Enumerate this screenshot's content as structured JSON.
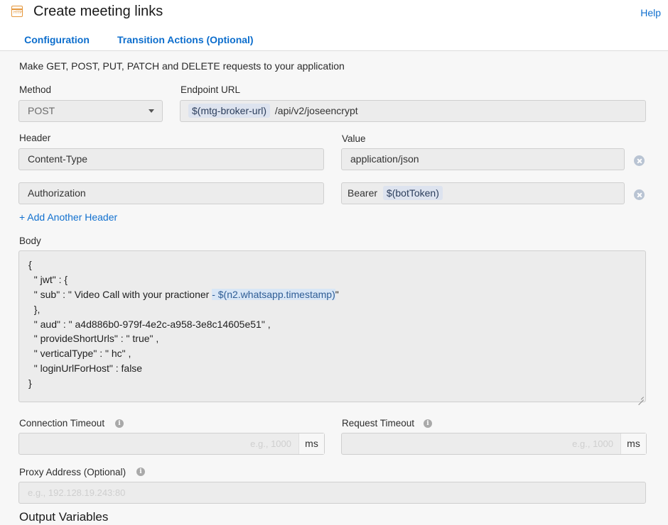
{
  "header": {
    "app_icon": "http-request-icon",
    "app_icon_text": "HTTP",
    "title": "Create meeting links",
    "help_label": "Help",
    "tabs": [
      {
        "label": "Configuration",
        "active": true
      },
      {
        "label": "Transition Actions (Optional)",
        "active": false
      }
    ]
  },
  "main": {
    "description": "Make GET, POST, PUT, PATCH and DELETE requests to your application",
    "method": {
      "label": "Method",
      "value": "POST"
    },
    "endpoint": {
      "label": "Endpoint URL",
      "variable": "$(mtg-broker-url)",
      "path": "/api/v2/joseencrypt"
    },
    "headers": {
      "header_label": "Header",
      "value_label": "Value",
      "rows": [
        {
          "header": "Content-Type",
          "value_text": "application/json",
          "value_var": ""
        },
        {
          "header": "Authorization",
          "value_text": "Bearer",
          "value_var": "$(botToken)"
        }
      ],
      "add_label": "+ Add Another Header"
    },
    "body": {
      "label": "Body",
      "lines": [
        "{",
        "  \" jwt\" : {",
        "  \" sub\" : \" Video Call with your practioner ",
        "  },",
        "  \" aud\" : \" a4d886b0-979f-4e2c-a958-3e8c14605e51\" ,",
        "  \" provideShortUrls\" : \" true\" ,",
        "  \" verticalType\" : \" hc\" ,",
        "  \" loginUrlForHost\" : false",
        "}"
      ],
      "sub_variable": "- $(n2.whatsapp.timestamp)",
      "sub_suffix": "\""
    },
    "connection_timeout": {
      "label": "Connection Timeout",
      "placeholder": "e.g., 1000",
      "unit": "ms"
    },
    "request_timeout": {
      "label": "Request Timeout",
      "placeholder": "e.g., 1000",
      "unit": "ms"
    },
    "proxy": {
      "label": "Proxy Address (Optional)",
      "placeholder": "e.g., 192.128.19.243:80"
    },
    "output_variables_title": "Output Variables"
  },
  "colors": {
    "accent": "#1170cf",
    "icon_orange": "#e5973c",
    "field_bg": "#ececec",
    "content_bg": "#f7f7f7"
  }
}
